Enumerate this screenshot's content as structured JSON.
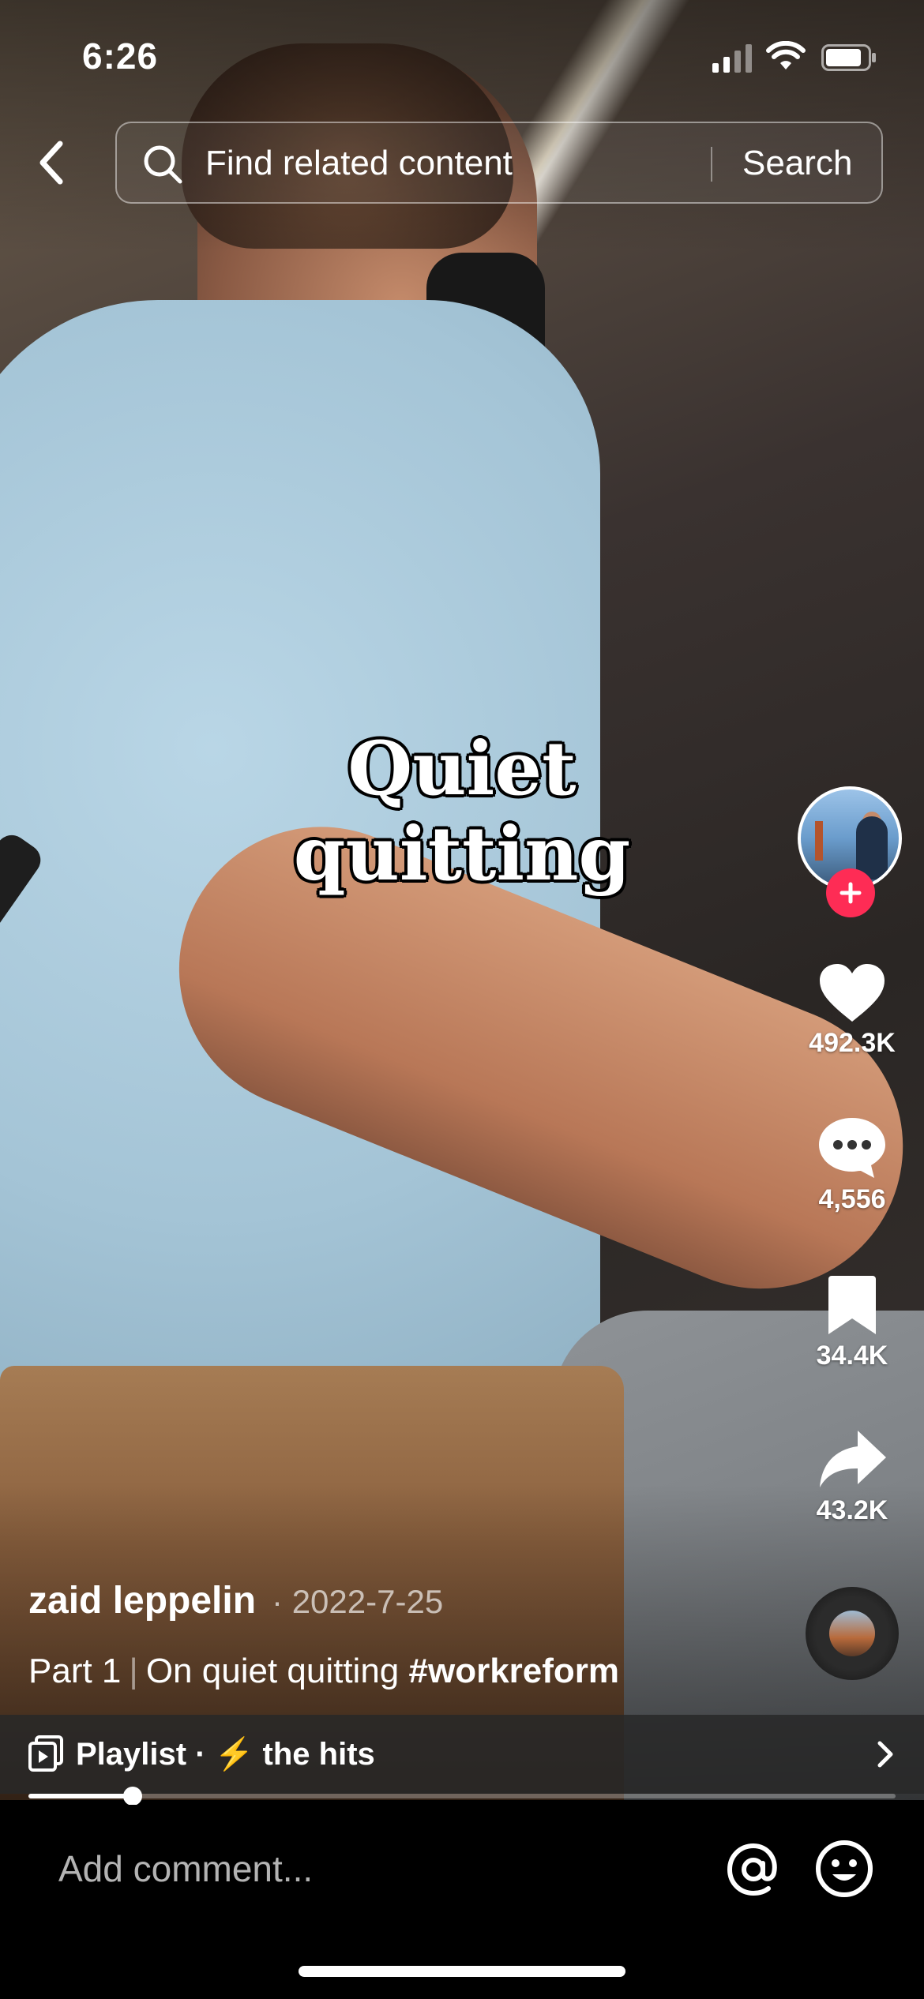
{
  "status_bar": {
    "time": "6:26"
  },
  "search": {
    "placeholder": "Find related content",
    "button_label": "Search"
  },
  "video": {
    "caption": "Quiet quitting"
  },
  "actions": {
    "likes": "492.3K",
    "comments": "4,556",
    "bookmarks": "34.4K",
    "shares": "43.2K"
  },
  "post": {
    "author": "zaid leppelin",
    "date": "· 2022-7-25",
    "part": "Part 1",
    "separator": "|",
    "text": "On quiet quitting",
    "hashtag": "#workreform"
  },
  "playlist": {
    "label": "Playlist · ⚡ the hits"
  },
  "playback": {
    "progress": 0.12
  },
  "comment_bar": {
    "placeholder": "Add comment..."
  },
  "colors": {
    "follow": "#fe2c55",
    "background": "#000000"
  }
}
